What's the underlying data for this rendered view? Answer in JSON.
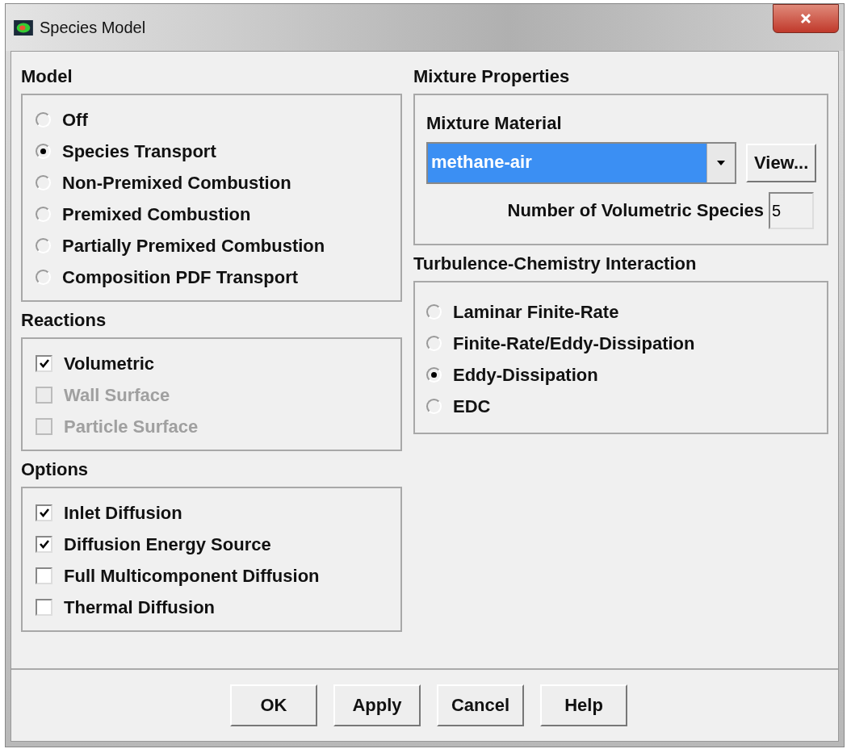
{
  "window": {
    "title": "Species Model"
  },
  "model": {
    "title": "Model",
    "options": [
      {
        "label": "Off",
        "selected": false
      },
      {
        "label": "Species Transport",
        "selected": true
      },
      {
        "label": "Non-Premixed Combustion",
        "selected": false
      },
      {
        "label": "Premixed Combustion",
        "selected": false
      },
      {
        "label": "Partially Premixed Combustion",
        "selected": false
      },
      {
        "label": "Composition PDF Transport",
        "selected": false
      }
    ]
  },
  "reactions": {
    "title": "Reactions",
    "options": [
      {
        "label": "Volumetric",
        "checked": true,
        "disabled": false
      },
      {
        "label": "Wall Surface",
        "checked": false,
        "disabled": true
      },
      {
        "label": "Particle Surface",
        "checked": false,
        "disabled": true
      }
    ]
  },
  "options": {
    "title": "Options",
    "options": [
      {
        "label": "Inlet Diffusion",
        "checked": true,
        "disabled": false
      },
      {
        "label": "Diffusion Energy Source",
        "checked": true,
        "disabled": false
      },
      {
        "label": "Full Multicomponent Diffusion",
        "checked": false,
        "disabled": false
      },
      {
        "label": "Thermal Diffusion",
        "checked": false,
        "disabled": false
      }
    ]
  },
  "mixture_properties": {
    "title": "Mixture Properties",
    "material_label": "Mixture Material",
    "material_value": "methane-air",
    "view_button": "View...",
    "species_label": "Number of Volumetric Species",
    "species_value": "5"
  },
  "turbulence_chemistry": {
    "title": "Turbulence-Chemistry Interaction",
    "options": [
      {
        "label": "Laminar Finite-Rate",
        "selected": false
      },
      {
        "label": "Finite-Rate/Eddy-Dissipation",
        "selected": false
      },
      {
        "label": "Eddy-Dissipation",
        "selected": true
      },
      {
        "label": "EDC",
        "selected": false
      }
    ]
  },
  "buttons": [
    "OK",
    "Apply",
    "Cancel",
    "Help"
  ]
}
